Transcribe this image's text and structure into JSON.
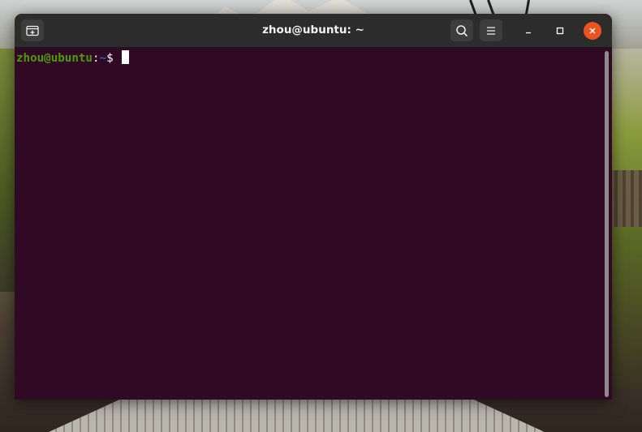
{
  "window": {
    "title": "zhou@ubuntu: ~"
  },
  "titlebar": {
    "icons": {
      "new_tab": "new-tab-icon",
      "search": "search-icon",
      "menu": "hamburger-menu-icon",
      "minimize": "minimize-icon",
      "maximize": "maximize-icon",
      "close": "close-icon"
    }
  },
  "terminal": {
    "prompt_user_host": "zhou@ubuntu",
    "prompt_colon": ":",
    "prompt_path": "~",
    "prompt_symbol": "$ "
  },
  "colors": {
    "terminal_bg": "#300a24",
    "titlebar_bg": "#2c2c2c",
    "prompt_user": "#4e9a06",
    "prompt_path": "#3465a4",
    "close_button": "#e95420"
  }
}
